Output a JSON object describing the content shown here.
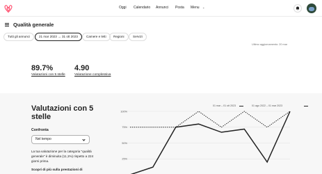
{
  "header": {
    "nav": [
      "Oggi",
      "Calendario",
      "Annunci",
      "Posta",
      "Menu"
    ]
  },
  "page": {
    "title": "Qualità generale"
  },
  "filters": {
    "chips": [
      "Tutti gli annunci",
      "21 mar 2023 → 31 ott 2023",
      "Camere e letti",
      "Regioni",
      "Servizi"
    ],
    "active_index": 1
  },
  "updated": "Ultimo aggiornamento: 20 mar",
  "kpis": [
    {
      "value": "89.7%",
      "label": "Valutazioni con 5 stelle"
    },
    {
      "value": "4.90",
      "label": "Valutazione complessiva"
    }
  ],
  "section": {
    "title": "Valutazioni con 5 stelle",
    "compare_label": "Confronta",
    "compare_value": "Nel tempo",
    "description": "La tua valutazione per la categoria \"qualità generale\" è diminuita (11,1%) rispetto a 224 giorni prima.",
    "more": "Scopri di più sulla prestazioni di"
  },
  "chart_data": {
    "type": "line",
    "legend": [
      "01 mar – 01 ott 2023",
      "01 ago 2022 – 01 mar 2023"
    ],
    "yticks": [
      "100%",
      "75%",
      "50%",
      "25%"
    ],
    "ylim": [
      0,
      100
    ],
    "x": [
      0,
      1,
      2,
      3,
      4,
      5,
      6,
      7
    ],
    "series": [
      {
        "name": "01 mar – 01 ott 2023",
        "style": "solid",
        "values": [
          0,
          12,
          75,
          80,
          67,
          72,
          20,
          100
        ]
      },
      {
        "name": "01 ago 2022 – 01 mar 2023",
        "style": "dashed",
        "values": [
          75,
          75,
          75,
          100,
          75,
          100,
          75,
          100
        ]
      }
    ]
  }
}
